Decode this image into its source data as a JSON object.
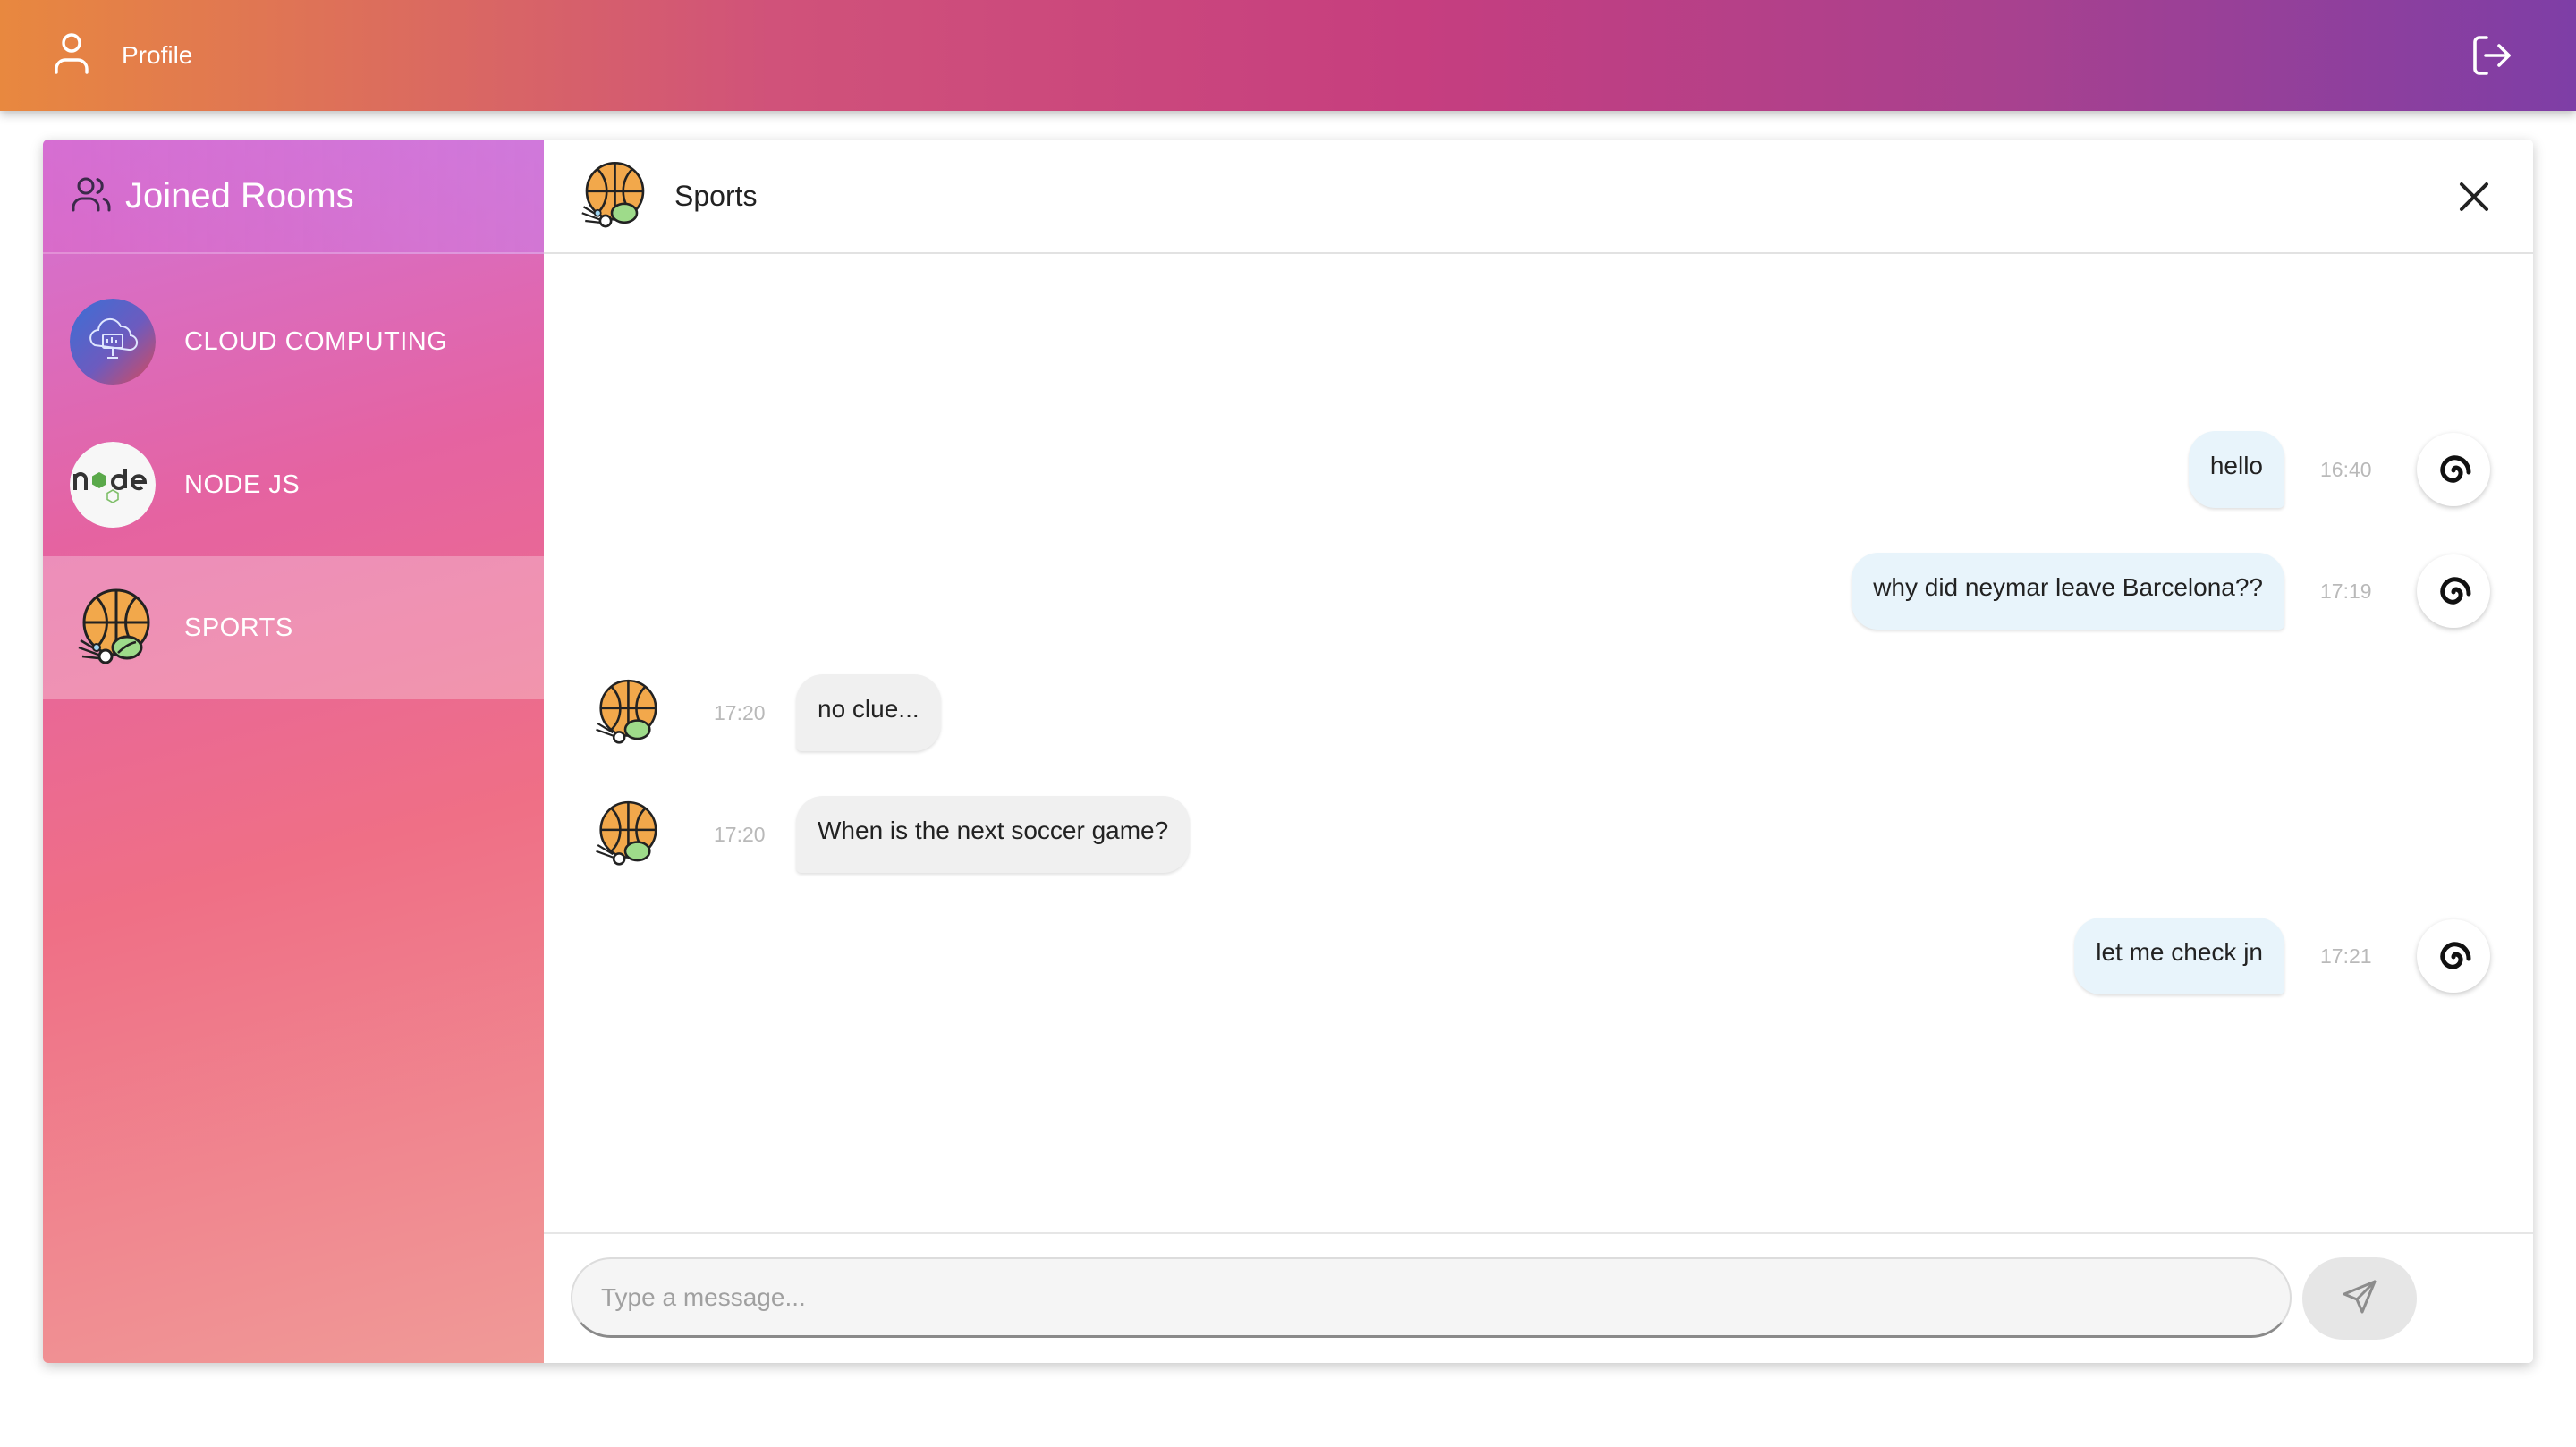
{
  "topbar": {
    "profile_label": "Profile",
    "profile_icon": "user-icon",
    "logout_icon": "logout-icon",
    "gradient_colors": [
      "#e8883f",
      "#c63e7f",
      "#7e3ea6"
    ]
  },
  "sidebar": {
    "title": "Joined Rooms",
    "title_icon": "users-icon",
    "rooms": [
      {
        "label": "CLOUD COMPUTING",
        "icon": "cloud-computing-icon",
        "active": false
      },
      {
        "label": "NODE JS",
        "icon": "nodejs-logo-icon",
        "active": false
      },
      {
        "label": "SPORTS",
        "icon": "sports-ball-icon",
        "active": true
      }
    ]
  },
  "chat": {
    "title": "Sports",
    "header_icon": "sports-ball-icon",
    "close_icon": "close-icon",
    "messages": [
      {
        "text": "hello",
        "time": "16:40",
        "mine": true
      },
      {
        "text": "why did neymar leave Barcelona??",
        "time": "17:19",
        "mine": true
      },
      {
        "text": "no clue...",
        "time": "17:20",
        "mine": false
      },
      {
        "text": "When is the next soccer game?",
        "time": "17:20",
        "mine": false
      },
      {
        "text": "let me check jn",
        "time": "17:21",
        "mine": true
      }
    ],
    "composer": {
      "placeholder": "Type a message...",
      "value": "",
      "send_icon": "send-icon"
    }
  }
}
